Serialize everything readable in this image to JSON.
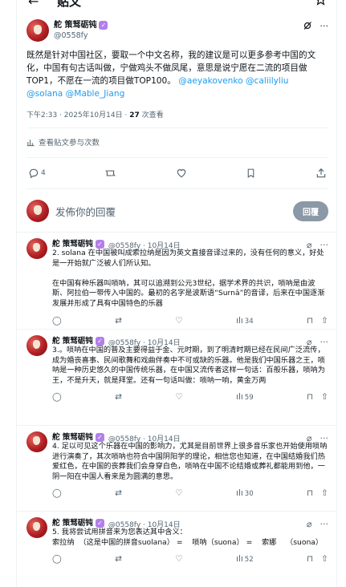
{
  "topbar": {
    "back": "←",
    "title": "贴文"
  },
  "post": {
    "display_name": "舵 策驽砺钝",
    "handle": "@0558fy",
    "text_plain": "既然是针对中国社区，要取一个中文名称，我的建议是可以更多参考中国的文化，中国有句古话叫做，宁做鸡头不做凤尾，意思是说宁愿在二流的项目做TOP1，不愿在一流的项目做TOP100。",
    "mentions_line1": " @aeyakovenko @caliilyliu",
    "mentions_line2": "@solana @Mable_Jiang",
    "time": "下午2:33 · 2025年10月14日 · ",
    "views_count": "27",
    "views_label": " 次查看",
    "stats_label": "查看贴文参与次数",
    "reply_count": "4"
  },
  "compose": {
    "placeholder": "发佈你的回覆",
    "button": "回覆"
  },
  "replies": [
    {
      "display_name": "舵 策驽砺钝",
      "handle_time": "@0558fy · 10月14日",
      "text": "2. solana 在中国被叫成索拉纳是因为英文直接音译过来的，没有任何的意义，好处是一开始就广泛被人们所认知。\n\n在中国有种乐器叫唢呐，其可以追溯到公元3世纪，据学术界的共识，唢呐是由波斯、阿拉伯一带传入中国的。最初的名字是波斯语“Surnā”的音译，后来在中国逐渐发展并形成了具有中国特色的乐器",
      "views": "34"
    },
    {
      "display_name": "舵 策驽砺钝",
      "handle_time": "@0558fy · 10月14日",
      "text": "3.。唢呐在中国的普及主要得益于金、元时期，到了明清时期已经在民间广泛流传，成为婚丧喜事、民间歌舞和戏曲伴奏中不可或缺的乐器。他是我们中国乐器之王，唢呐是一种历史悠久的中国传统乐器，在中国又流传者这样一句话：百般乐器，唢呐为王，不是升天，就是拜堂。还有一句话叫做：唢呐一响，黄金万两",
      "views": "59"
    },
    {
      "display_name": "舵 策驽砺钝",
      "handle_time": "@0558fy · 10月14日",
      "text": "4. 足以可见这个乐器在中国的影响力，尤其是目前世界上很多音乐家也开始使用唢呐进行演奏了，其次唢呐也符合中国阴阳学的理论，相信您也知道，在中国结婚我们热爱红色，在中国的丧葬我们会身穿白色，唢呐在中国不论结婚或葬礼都能用到他，一阴一阳在中国人看来是为圆满的意思。",
      "views": "30"
    },
    {
      "display_name": "舵 策驽砺钝",
      "handle_time": "@0558fy · 10月14日",
      "text": "5. 我将尝试用拼音来为您表达其中含义：\n索拉纳  （这是中国的拼音suolana） =    唢呐（suona） =    索娜    （suona）",
      "views": "52"
    }
  ],
  "colors": {
    "accent": "#1d9bf0",
    "badge": "#b37feb",
    "muted": "#536471",
    "button": "#8b98a5"
  }
}
